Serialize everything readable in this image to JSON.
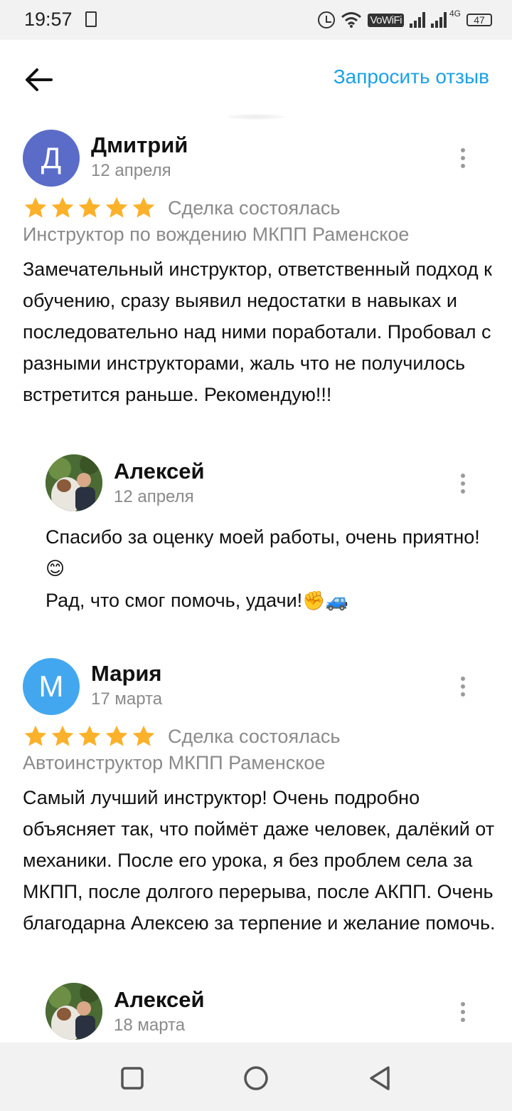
{
  "status_bar": {
    "time": "19:57",
    "vowifi": "VoWiFi",
    "network": "4G",
    "battery": "47"
  },
  "header": {
    "request_review": "Запросить отзыв"
  },
  "colors": {
    "accent": "#1ba1e6",
    "star": "#fbb12a",
    "avatar_d": "#5b6cc8",
    "avatar_m": "#43a7f0"
  },
  "reviews": [
    {
      "avatar_letter": "Д",
      "author": "Дмитрий",
      "date": "12 апреля",
      "stars": 5,
      "deal_status": "Сделка состоялась",
      "category": "Инструктор по вождению МКПП Раменское",
      "text": "Замечательный инструктор, ответственный подход к обучению, сразу выявил недостатки в навыках и последовательно над ними поработали. Пробовал с разными инструкторами, жаль что не получилось встретится раньше. Рекомендую!!!",
      "reply": {
        "author": "Алексей",
        "date": "12 апреля",
        "line1": "Спасибо за оценку моей работы, очень приятно!",
        "emoji1": "😊",
        "line2": "Рад, что смог помочь, удачи!",
        "emoji2": "✊",
        "emoji3": "🚙"
      }
    },
    {
      "avatar_letter": "М",
      "author": "Мария",
      "date": "17 марта",
      "stars": 5,
      "deal_status": "Сделка состоялась",
      "category": "Автоинструктор МКПП Раменское",
      "text": "Самый лучший инструктор! Очень подробно объясняет так, что поймёт даже человек, далёкий от механики. После его урока, я без проблем села за МКПП, после долгого перерыва, после АКПП. Очень благодарна Алексею за терпение и желание помочь.",
      "reply": {
        "author": "Алексей",
        "date": "18 марта"
      }
    }
  ]
}
